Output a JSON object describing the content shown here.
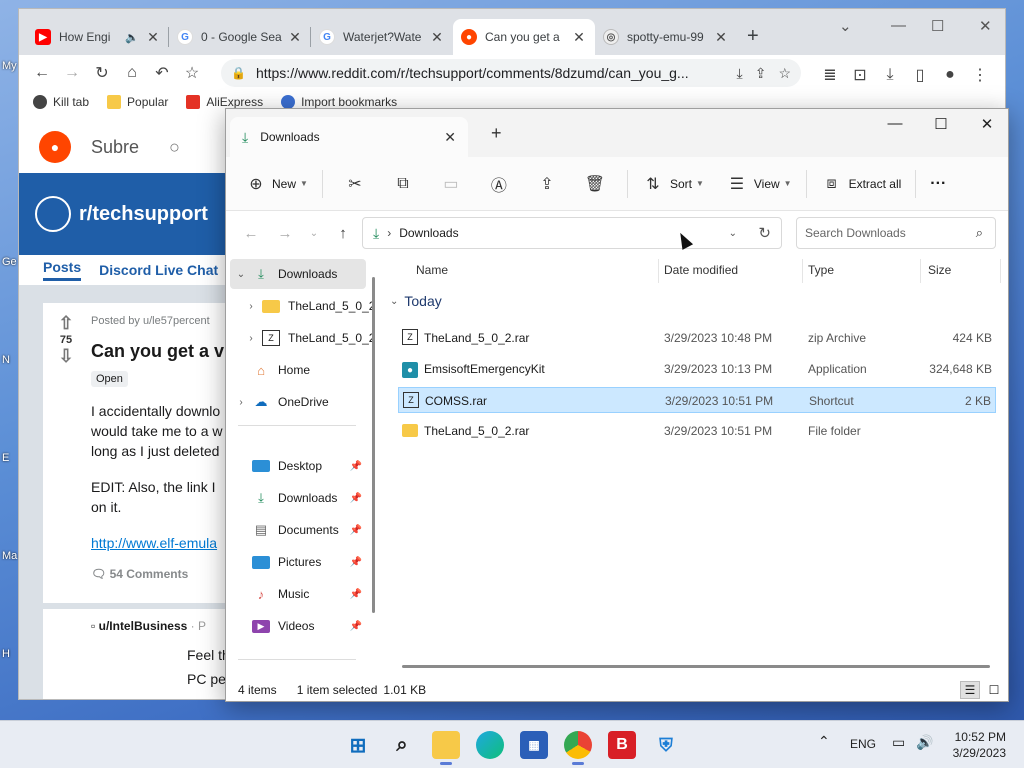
{
  "desktop": {
    "edge_labels": [
      "My",
      "Ge",
      "N",
      "E",
      "Ma",
      "H"
    ]
  },
  "chrome": {
    "tabs": [
      {
        "label": "How Engi",
        "favicon": "youtube-icon"
      },
      {
        "label": "0 - Google Sea",
        "favicon": "google-icon"
      },
      {
        "label": "Waterjet?Wate",
        "favicon": "google-icon"
      },
      {
        "label": "Can you get a",
        "favicon": "reddit-icon"
      },
      {
        "label": "spotty-emu-99",
        "favicon": "globe-icon"
      }
    ],
    "url": "https://www.reddit.com/r/techsupport/comments/8dzumd/can_you_g...",
    "bookmarks": [
      {
        "label": "Kill tab"
      },
      {
        "label": "Popular"
      },
      {
        "label": "AliExpress"
      },
      {
        "label": "Import bookmarks"
      }
    ]
  },
  "reddit": {
    "search_placeholder": "Subre",
    "subreddit_title": "r/techsupport",
    "nav": {
      "posts": "Posts",
      "discord": "Discord Live Chat"
    },
    "post": {
      "meta": "Posted by u/le57percent",
      "title": "Can you get a v",
      "votes": "75",
      "flair": "Open",
      "body_lines": [
        "I accidentally downlo",
        "would take me to a w",
        "long as I just deleted"
      ],
      "edit_lines": [
        "EDIT: Also, the link I",
        "on it."
      ],
      "link": "http://www.elf-emula",
      "comments": "54 Comments"
    },
    "reply": {
      "user": "u/IntelBusiness",
      "dot": "·",
      "tail": "P",
      "lines": [
        "Feel th",
        "PC pe"
      ]
    }
  },
  "explorer": {
    "tab_title": "Downloads",
    "commands": {
      "new": "New",
      "sort": "Sort",
      "view": "View",
      "extract": "Extract all",
      "more": "···"
    },
    "address": {
      "location": "Downloads"
    },
    "search_placeholder": "Search Downloads",
    "nav": {
      "downloads_selected": "Downloads",
      "sub1": "TheLand_5_0_2",
      "sub2": "TheLand_5_0_2",
      "home": "Home",
      "onedrive": "OneDrive",
      "desktop": "Desktop",
      "downloads": "Downloads",
      "documents": "Documents",
      "pictures": "Pictures",
      "music": "Music",
      "videos": "Videos"
    },
    "columns": {
      "name": "Name",
      "date": "Date modified",
      "type": "Type",
      "size": "Size"
    },
    "group": "Today",
    "files": [
      {
        "name": "TheLand_5_0_2.rar",
        "date": "3/29/2023 10:48 PM",
        "type": "zip Archive",
        "size": "424 KB",
        "icon": "archive-icon"
      },
      {
        "name": "EmsisoftEmergencyKit",
        "date": "3/29/2023 10:13 PM",
        "type": "Application",
        "size": "324,648 KB",
        "icon": "app-icon"
      },
      {
        "name": "COMSS.rar",
        "date": "3/29/2023 10:51 PM",
        "type": "Shortcut",
        "size": "2 KB",
        "icon": "shortcut-icon"
      },
      {
        "name": "TheLand_5_0_2.rar",
        "date": "3/29/2023 10:51 PM",
        "type": "File folder",
        "size": "",
        "icon": "folder-icon"
      }
    ],
    "status": {
      "count": "4 items",
      "selected": "1 item selected",
      "size": "1.01 KB"
    }
  },
  "taskbar": {
    "language": "ENG",
    "time": "10:52 PM",
    "date": "3/29/2023"
  }
}
